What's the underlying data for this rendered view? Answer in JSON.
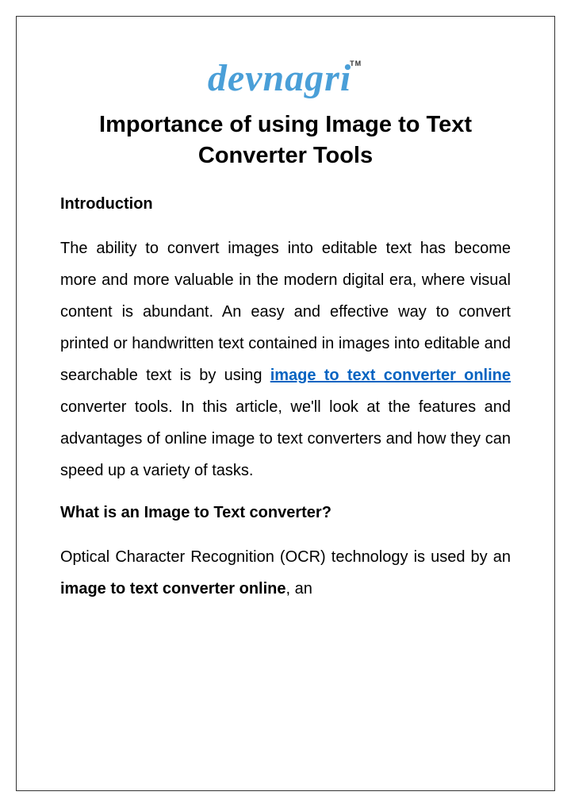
{
  "logo": {
    "text": "devnagri",
    "tm": "TM"
  },
  "title": "Importance of using Image to Text Converter Tools",
  "section1": {
    "heading": "Introduction",
    "para_part1": "The ability to convert images into editable text has become more and more valuable in the modern digital era, where visual content is abundant. An easy and effective way to convert printed or handwritten text contained in images into editable and searchable text is by using ",
    "link_text": "image to text converter online",
    "para_part2": " converter tools. In this article, we'll look at the features and advantages of online image to text converters and how they can speed up a variety of tasks."
  },
  "section2": {
    "heading": "What is an Image to Text converter?",
    "para_part1": "Optical Character Recognition (OCR) technology is used by an ",
    "bold_text": "image to text converter online",
    "para_part2": ", an"
  }
}
